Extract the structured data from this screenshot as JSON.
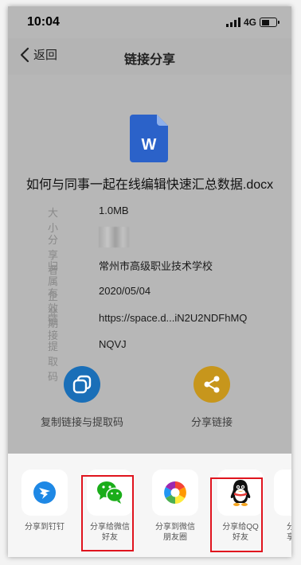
{
  "status": {
    "time": "10:04",
    "network": "4G"
  },
  "nav": {
    "back_label": "返回",
    "title": "链接分享"
  },
  "file": {
    "name": "如何与同事一起在线编辑快速汇总数据.docx",
    "icon_letter": "W"
  },
  "info": [
    {
      "label": "大小",
      "value": "1.0MB"
    },
    {
      "label": "分享者",
      "value": ""
    },
    {
      "label": "归属企业",
      "value": "常州市高级职业技术学校"
    },
    {
      "label": "有效期",
      "value": "2020/05/04"
    },
    {
      "label": "链接",
      "value": "https://space.d...iN2U2NDFhMQ"
    },
    {
      "label": "提取码",
      "value": "NQVJ"
    }
  ],
  "actions": {
    "copy_label": "复制链接与提取码",
    "share_label": "分享链接"
  },
  "share_sheet": [
    {
      "label": "分享到钉钉",
      "icon": "dingtalk-icon"
    },
    {
      "label": "分享给微信\n好友",
      "icon": "wechat-icon"
    },
    {
      "label": "分享到微信\n朋友圈",
      "icon": "wechat-moments-icon"
    },
    {
      "label": "分享给QQ\n好友",
      "icon": "qq-icon"
    },
    {
      "label": "分\n享",
      "icon": "partial-app-icon"
    }
  ],
  "colors": {
    "copy_circle": "#1a6fb8",
    "share_circle": "#c7961c",
    "word_blue": "#2b62c9",
    "highlight": "#e0141e"
  }
}
